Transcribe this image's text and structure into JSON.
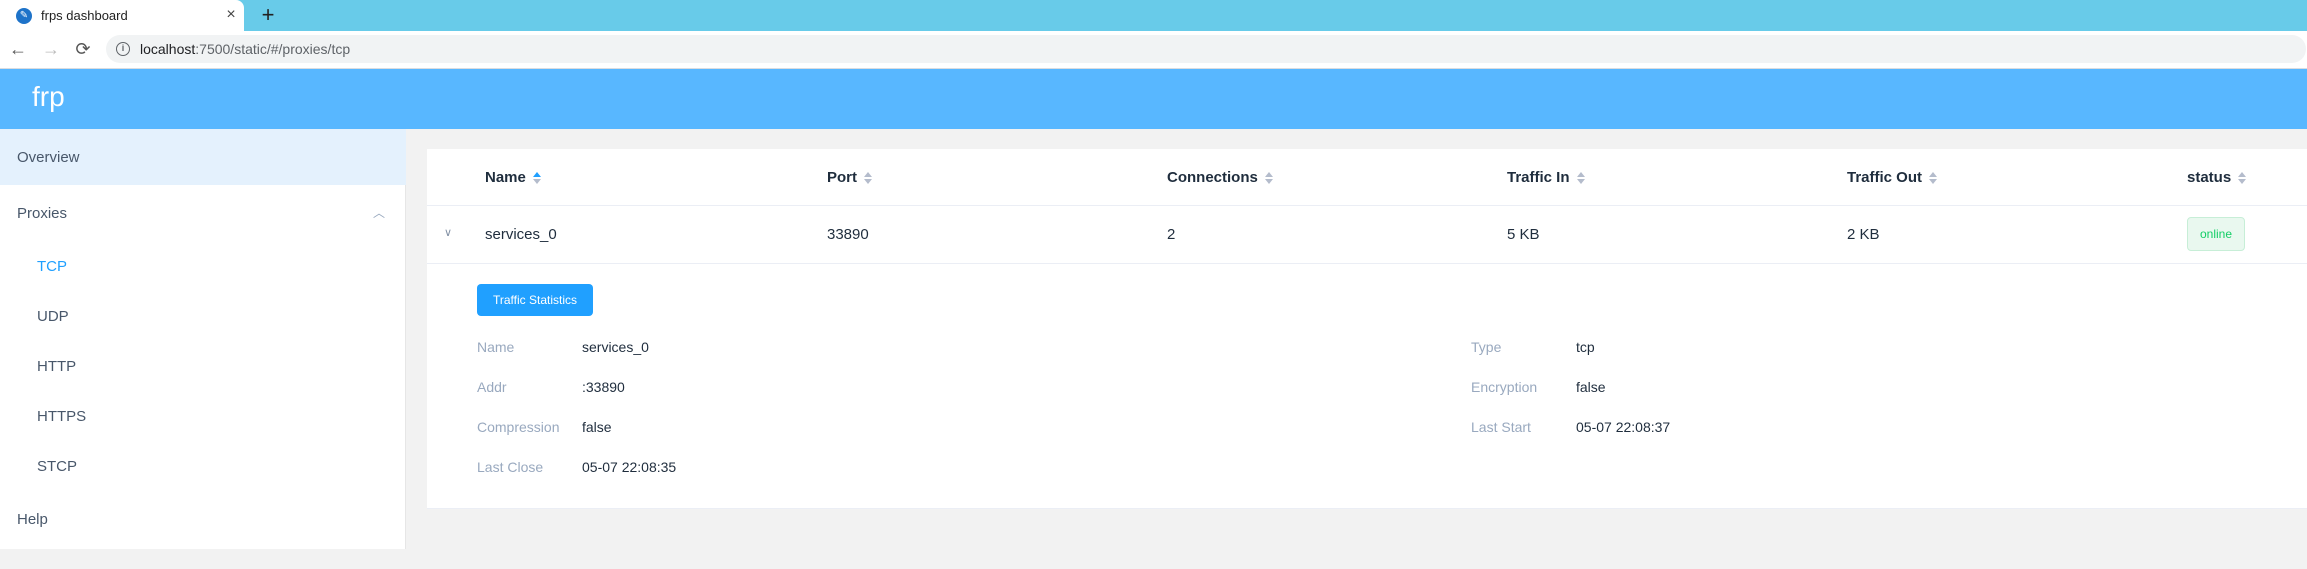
{
  "browser": {
    "tab_title": "frps dashboard",
    "tab_close": "×",
    "new_tab": "+",
    "url_host": "localhost",
    "url_rest": ":7500/static/#/proxies/tcp",
    "back_icon": "←",
    "forward_icon": "→",
    "reload_icon": "⟳"
  },
  "header": {
    "brand": "frp"
  },
  "sidebar": {
    "overview": "Overview",
    "proxies": "Proxies",
    "proxies_chevron": "^",
    "subitems": [
      "TCP",
      "UDP",
      "HTTP",
      "HTTPS",
      "STCP"
    ],
    "selected": "TCP",
    "help": "Help"
  },
  "table": {
    "headers": {
      "name": "Name",
      "port": "Port",
      "connections": "Connections",
      "traffic_in": "Traffic In",
      "traffic_out": "Traffic Out",
      "status": "status"
    },
    "sorted_column": "Name",
    "rows": [
      {
        "name": "services_0",
        "port": "33890",
        "connections": "2",
        "traffic_in": "5 KB",
        "traffic_out": "2 KB",
        "status": "online",
        "expanded": true
      }
    ]
  },
  "details": {
    "button": "Traffic Statistics",
    "name_label": "Name",
    "name_value": "services_0",
    "type_label": "Type",
    "type_value": "tcp",
    "addr_label": "Addr",
    "addr_value": ":33890",
    "encryption_label": "Encryption",
    "encryption_value": "false",
    "compression_label": "Compression",
    "compression_value": "false",
    "last_start_label": "Last Start",
    "last_start_value": "05-07 22:08:37",
    "last_close_label": "Last Close",
    "last_close_value": "05-07 22:08:35"
  },
  "colors": {
    "header_bg": "#58b7ff",
    "tabstrip_bg": "#68cbe9",
    "accent": "#20a0ff",
    "online": "#13ce66"
  }
}
